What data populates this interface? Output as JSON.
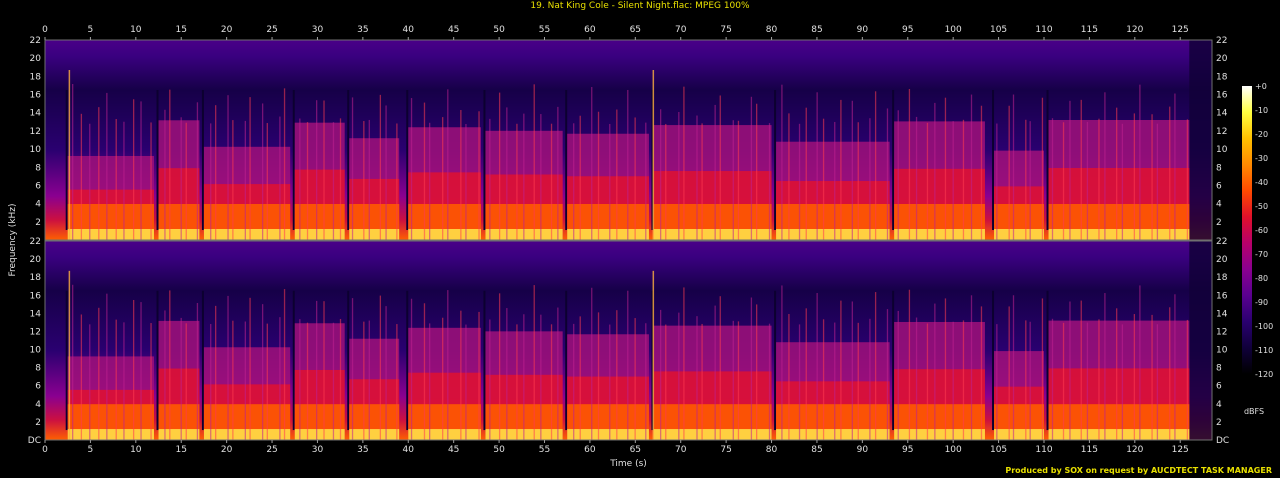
{
  "title": "19. Nat King Cole - Silent Night.flac: MPEG 100%",
  "credit": "Produced by SOX on request by AUCDTECT TASK MANAGER",
  "chart_data": {
    "type": "heatmap",
    "title": "19. Nat King Cole - Silent Night.flac: MPEG 100%",
    "xlabel": "Time (s)",
    "ylabel": "Frequency (kHz)",
    "colorbar_label": "dBFS",
    "xlim": [
      0,
      128.5
    ],
    "ylim": [
      0,
      22
    ],
    "zlim": [
      -120,
      0
    ],
    "x_ticks": [
      0,
      5,
      10,
      15,
      20,
      25,
      30,
      35,
      40,
      45,
      50,
      55,
      60,
      65,
      70,
      75,
      80,
      85,
      90,
      95,
      100,
      105,
      110,
      115,
      120,
      125
    ],
    "y_ticks": [
      "DC",
      "2",
      "4",
      "6",
      "8",
      "10",
      "12",
      "14",
      "16",
      "18",
      "20",
      "22"
    ],
    "colorbar_ticks": [
      "+0",
      "-10",
      "-20",
      "-30",
      "-40",
      "-50",
      "-60",
      "-70",
      "-80",
      "-90",
      "-100",
      "-110",
      "-120"
    ],
    "channels": [
      {
        "name": "",
        "loud_segments": [
          [
            2.5,
            12
          ],
          [
            12.5,
            17
          ],
          [
            17.5,
            27
          ],
          [
            27.5,
            33
          ],
          [
            33.5,
            39
          ],
          [
            40,
            48
          ],
          [
            48.5,
            57
          ],
          [
            57.5,
            66.5
          ],
          [
            67,
            80
          ],
          [
            80.5,
            93
          ],
          [
            93.5,
            103.5
          ],
          [
            104.5,
            110
          ],
          [
            110.5,
            126
          ]
        ]
      },
      {
        "name": "",
        "loud_segments": [
          [
            2.5,
            12
          ],
          [
            12.5,
            17
          ],
          [
            17.5,
            27
          ],
          [
            27.5,
            33
          ],
          [
            33.5,
            39
          ],
          [
            40,
            48
          ],
          [
            48.5,
            57
          ],
          [
            57.5,
            66.5
          ],
          [
            67,
            80
          ],
          [
            80.5,
            93
          ],
          [
            93.5,
            103.5
          ],
          [
            104.5,
            110
          ],
          [
            110.5,
            126
          ]
        ]
      }
    ],
    "colors": [
      "#000000",
      "#10003a",
      "#2a0070",
      "#5a0090",
      "#8a0090",
      "#b8006a",
      "#e0102a",
      "#ff4a00",
      "#ff8a00",
      "#ffc000",
      "#ffff40",
      "#ffffff"
    ]
  }
}
